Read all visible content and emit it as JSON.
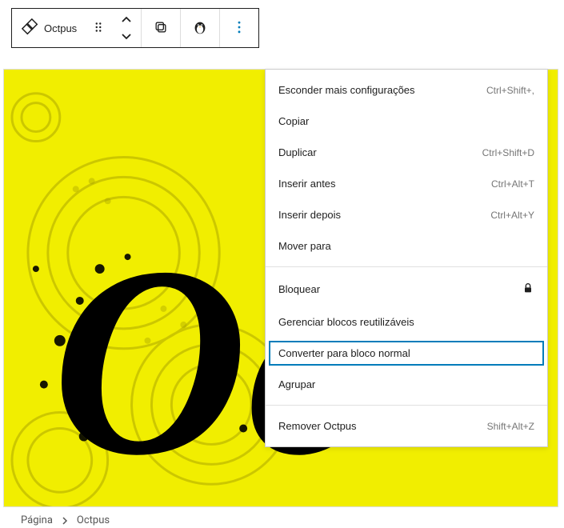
{
  "toolbar": {
    "block_label": "Octpus"
  },
  "menu": {
    "section1": [
      {
        "label": "Esconder mais configurações",
        "shortcut": "Ctrl+Shift+,"
      },
      {
        "label": "Copiar",
        "shortcut": ""
      },
      {
        "label": "Duplicar",
        "shortcut": "Ctrl+Shift+D"
      },
      {
        "label": "Inserir antes",
        "shortcut": "Ctrl+Alt+T"
      },
      {
        "label": "Inserir depois",
        "shortcut": "Ctrl+Alt+Y"
      },
      {
        "label": "Mover para",
        "shortcut": ""
      }
    ],
    "section2": [
      {
        "label": "Bloquear",
        "icon": "lock"
      },
      {
        "label": "Gerenciar blocos reutilizáveis",
        "shortcut": ""
      },
      {
        "label": "Converter para bloco normal",
        "shortcut": "",
        "highlighted": true
      },
      {
        "label": "Agrupar",
        "shortcut": ""
      }
    ],
    "section3": [
      {
        "label": "Remover Octpus",
        "shortcut": "Shift+Alt+Z"
      }
    ]
  },
  "breadcrumb": {
    "root": "Página",
    "current": "Octpus"
  }
}
